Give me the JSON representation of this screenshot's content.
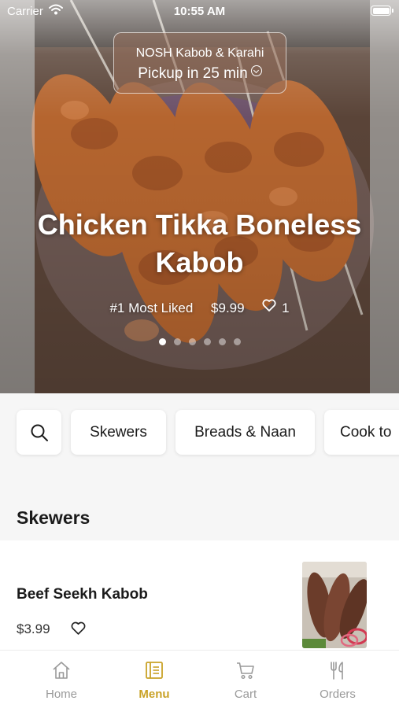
{
  "status_bar": {
    "carrier": "Carrier",
    "time": "10:55 AM"
  },
  "store": {
    "name": "NOSH Kabob & Karahi",
    "pickup": "Pickup in 25 min"
  },
  "hero": {
    "title": "Chicken Tikka Boneless Kabob",
    "tag": "#1 Most Liked",
    "price": "$9.99",
    "likes": "1",
    "pager": {
      "count": 6,
      "active_index": 0
    }
  },
  "categories": [
    "Skewers",
    "Breads & Naan",
    "Cook to"
  ],
  "section_title": "Skewers",
  "item": {
    "name": "Beef Seekh Kabob",
    "price": "$3.99"
  },
  "tabs": [
    {
      "label": "Home",
      "icon": "home-icon"
    },
    {
      "label": "Menu",
      "icon": "menu-icon",
      "active": true
    },
    {
      "label": "Cart",
      "icon": "cart-icon"
    },
    {
      "label": "Orders",
      "icon": "orders-icon"
    }
  ],
  "colors": {
    "accent": "#c9a227",
    "inactive_tab": "#9a9a9a",
    "background": "#f6f6f6"
  }
}
